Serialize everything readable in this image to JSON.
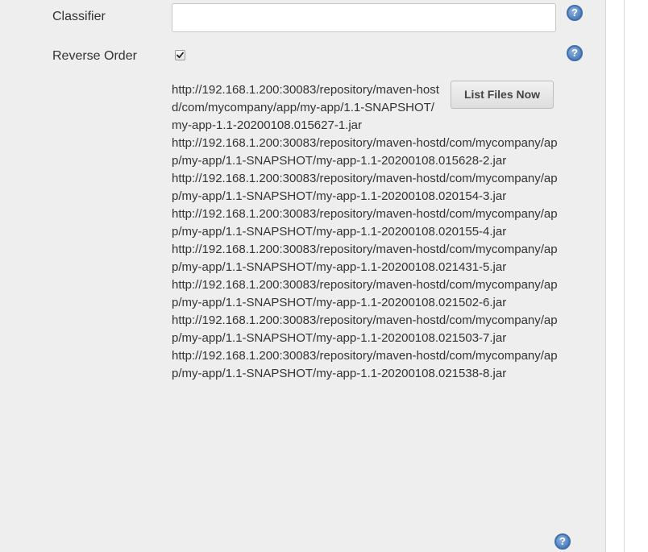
{
  "fields": {
    "classifier": {
      "label": "Classifier",
      "value": "",
      "placeholder": ""
    },
    "reverse_order": {
      "label": "Reverse Order",
      "checked": true
    }
  },
  "help_icon_glyph": "?",
  "list_button_label": "List Files Now",
  "files": [
    "http://192.168.1.200:30083/repository/maven-hostd/com/mycompany/app/my-app/1.1-SNAPSHOT/my-app-1.1-20200108.015627-1.jar",
    "http://192.168.1.200:30083/repository/maven-hostd/com/mycompany/app/my-app/1.1-SNAPSHOT/my-app-1.1-20200108.015628-2.jar",
    "http://192.168.1.200:30083/repository/maven-hostd/com/mycompany/app/my-app/1.1-SNAPSHOT/my-app-1.1-20200108.020154-3.jar",
    "http://192.168.1.200:30083/repository/maven-hostd/com/mycompany/app/my-app/1.1-SNAPSHOT/my-app-1.1-20200108.020155-4.jar",
    "http://192.168.1.200:30083/repository/maven-hostd/com/mycompany/app/my-app/1.1-SNAPSHOT/my-app-1.1-20200108.021431-5.jar",
    "http://192.168.1.200:30083/repository/maven-hostd/com/mycompany/app/my-app/1.1-SNAPSHOT/my-app-1.1-20200108.021502-6.jar",
    "http://192.168.1.200:30083/repository/maven-hostd/com/mycompany/app/my-app/1.1-SNAPSHOT/my-app-1.1-20200108.021503-7.jar",
    "http://192.168.1.200:30083/repository/maven-hostd/com/mycompany/app/my-app/1.1-SNAPSHOT/my-app-1.1-20200108.021538-8.jar"
  ],
  "colors": {
    "panel_background": "#eeeeee",
    "help_icon": "#4a7bbd",
    "text": "#333333"
  },
  "icons": {
    "help": "help-icon",
    "check": "checkmark-icon"
  }
}
